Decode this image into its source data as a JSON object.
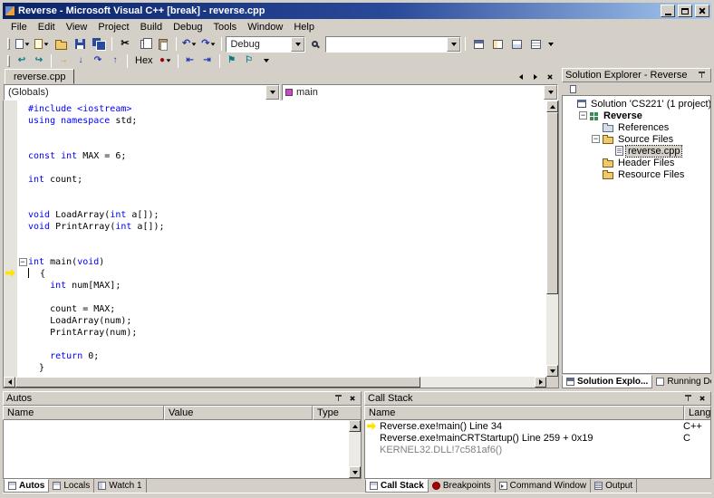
{
  "window": {
    "title": "Reverse - Microsoft Visual C++ [break] - reverse.cpp"
  },
  "menu": {
    "items": [
      "File",
      "Edit",
      "View",
      "Project",
      "Build",
      "Debug",
      "Tools",
      "Window",
      "Help"
    ]
  },
  "toolbars": {
    "config_combo_value": "Debug",
    "find_combo_value": "",
    "hex_button_label": "Hex"
  },
  "editor": {
    "tab_label": "reverse.cpp",
    "scope_combo_value": "(Globals)",
    "member_combo_value": "main",
    "current_line_index": 14,
    "lines": [
      {
        "tokens": [
          {
            "k": "kw",
            "s": "#include <iostream>"
          }
        ]
      },
      {
        "tokens": [
          {
            "k": "kw",
            "s": "using"
          },
          {
            "k": "t",
            "s": " "
          },
          {
            "k": "kw",
            "s": "namespace"
          },
          {
            "k": "t",
            "s": " std;"
          }
        ]
      },
      {
        "tokens": []
      },
      {
        "tokens": []
      },
      {
        "tokens": [
          {
            "k": "kw",
            "s": "const"
          },
          {
            "k": "t",
            "s": " "
          },
          {
            "k": "kw",
            "s": "int"
          },
          {
            "k": "t",
            "s": " MAX = 6;"
          }
        ]
      },
      {
        "tokens": []
      },
      {
        "tokens": [
          {
            "k": "kw",
            "s": "int"
          },
          {
            "k": "t",
            "s": " count;"
          }
        ]
      },
      {
        "tokens": []
      },
      {
        "tokens": []
      },
      {
        "tokens": [
          {
            "k": "kw",
            "s": "void"
          },
          {
            "k": "t",
            "s": " LoadArray("
          },
          {
            "k": "kw",
            "s": "int"
          },
          {
            "k": "t",
            "s": " a[]);"
          }
        ]
      },
      {
        "tokens": [
          {
            "k": "kw",
            "s": "void"
          },
          {
            "k": "t",
            "s": " PrintArray("
          },
          {
            "k": "kw",
            "s": "int"
          },
          {
            "k": "t",
            "s": " a[]);"
          }
        ]
      },
      {
        "tokens": []
      },
      {
        "tokens": []
      },
      {
        "fold": "minus",
        "tokens": [
          {
            "k": "kw",
            "s": "int"
          },
          {
            "k": "t",
            "s": " main("
          },
          {
            "k": "kw",
            "s": "void"
          },
          {
            "k": "t",
            "s": ")"
          }
        ]
      },
      {
        "caret": true,
        "tokens": [
          {
            "k": "t",
            "s": "  {"
          }
        ]
      },
      {
        "tokens": [
          {
            "k": "t",
            "s": "    "
          },
          {
            "k": "kw",
            "s": "int"
          },
          {
            "k": "t",
            "s": " num[MAX];"
          }
        ]
      },
      {
        "tokens": []
      },
      {
        "tokens": [
          {
            "k": "t",
            "s": "    count = MAX;"
          }
        ]
      },
      {
        "tokens": [
          {
            "k": "t",
            "s": "    LoadArray(num);"
          }
        ]
      },
      {
        "tokens": [
          {
            "k": "t",
            "s": "    PrintArray(num);"
          }
        ]
      },
      {
        "tokens": []
      },
      {
        "tokens": [
          {
            "k": "t",
            "s": "    "
          },
          {
            "k": "kw",
            "s": "return"
          },
          {
            "k": "t",
            "s": " 0;"
          }
        ]
      },
      {
        "tokens": [
          {
            "k": "t",
            "s": "  }"
          }
        ]
      }
    ]
  },
  "solution_explorer": {
    "title": "Solution Explorer - Reverse",
    "tree": [
      {
        "label": "Solution 'CS221' (1 project)",
        "level": 0,
        "icon": "solution-icon"
      },
      {
        "label": "Reverse",
        "level": 1,
        "icon": "project-icon",
        "expander": "minus",
        "bold": true
      },
      {
        "label": "References",
        "level": 2,
        "icon": "references-icon"
      },
      {
        "label": "Source Files",
        "level": 2,
        "icon": "folder-icon",
        "expander": "minus"
      },
      {
        "label": "reverse.cpp",
        "level": 3,
        "icon": "cpp-file-icon",
        "selected": true
      },
      {
        "label": "Header Files",
        "level": 2,
        "icon": "folder-icon"
      },
      {
        "label": "Resource Files",
        "level": 2,
        "icon": "folder-icon"
      }
    ],
    "tabs": [
      {
        "label": "Solution Explo...",
        "icon": "solution-explorer-icon",
        "active": true
      },
      {
        "label": "Running Docu...",
        "icon": "running-documents-icon",
        "active": false
      }
    ]
  },
  "autos_panel": {
    "title": "Autos",
    "columns": [
      "Name",
      "Value",
      "Type"
    ],
    "rows": [],
    "tabs": [
      {
        "label": "Autos",
        "icon": "autos-icon",
        "active": true
      },
      {
        "label": "Locals",
        "icon": "locals-icon",
        "active": false
      },
      {
        "label": "Watch 1",
        "icon": "watch-icon",
        "active": false
      }
    ]
  },
  "call_stack_panel": {
    "title": "Call Stack",
    "columns": [
      "Name",
      "Lang"
    ],
    "frames": [
      {
        "name": "Reverse.exe!main() Line 34",
        "lang": "C++",
        "current": true,
        "dim": false
      },
      {
        "name": "Reverse.exe!mainCRTStartup() Line 259 + 0x19",
        "lang": "C",
        "current": false,
        "dim": false
      },
      {
        "name": "KERNEL32.DLL!7c581af6()",
        "lang": "",
        "current": false,
        "dim": true
      }
    ],
    "tabs": [
      {
        "label": "Call Stack",
        "icon": "call-stack-icon",
        "active": true
      },
      {
        "label": "Breakpoints",
        "icon": "breakpoints-icon",
        "active": false
      },
      {
        "label": "Command Window",
        "icon": "command-window-icon",
        "active": false
      },
      {
        "label": "Output",
        "icon": "output-icon",
        "active": false
      }
    ]
  }
}
